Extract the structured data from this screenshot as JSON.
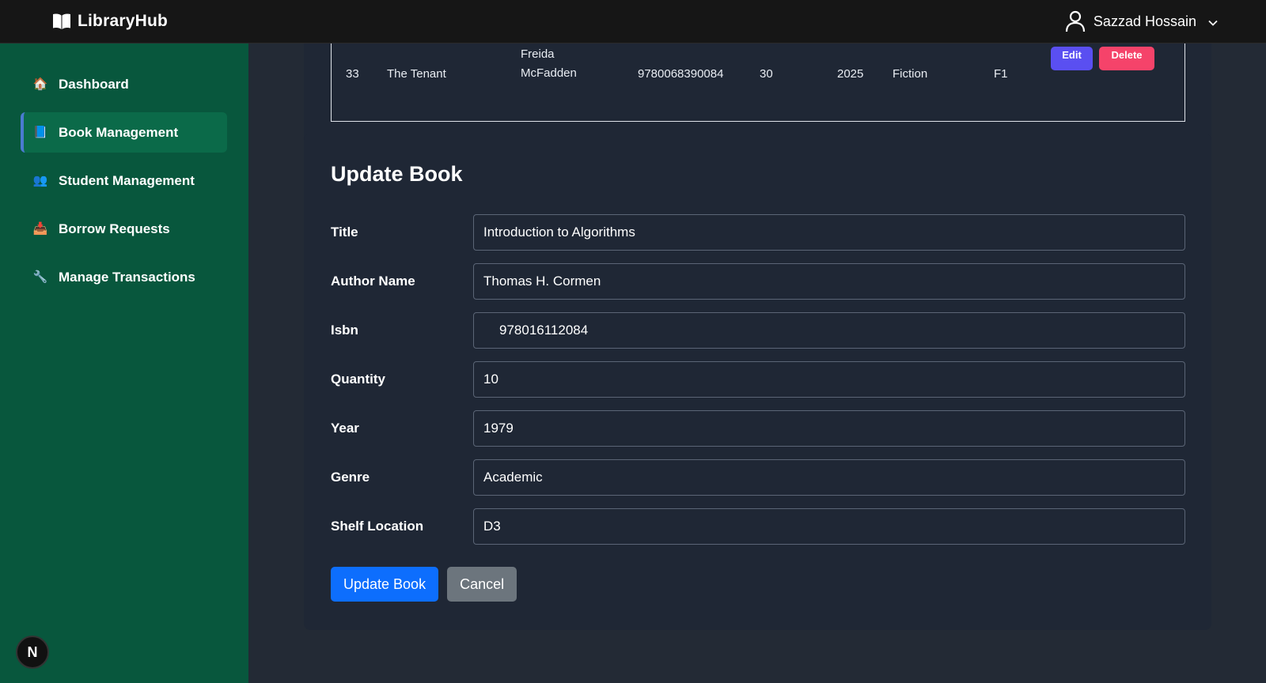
{
  "app": {
    "brand": "LibraryHub",
    "user_name": "Sazzad Hossain"
  },
  "sidebar": {
    "items": [
      {
        "label": "Dashboard",
        "icon": "🏠",
        "active": false
      },
      {
        "label": "Book Management",
        "icon": "📘",
        "active": true
      },
      {
        "label": "Student Management",
        "icon": "👥",
        "active": false
      },
      {
        "label": "Borrow Requests",
        "icon": "📥",
        "active": false
      },
      {
        "label": "Manage Transactions",
        "icon": "🔧",
        "active": false
      }
    ],
    "badge": "N"
  },
  "table": {
    "row": {
      "id": "33",
      "title": "The Tenant",
      "author_line1": "Freida",
      "author_line2": "McFadden",
      "isbn": "9780068390084",
      "quantity": "30",
      "year": "2025",
      "genre": "Fiction",
      "shelf": "F1",
      "edit_label": "Edit",
      "delete_label": "Delete"
    }
  },
  "form": {
    "title": "Update Book",
    "fields": [
      {
        "label": "Title",
        "value": "Introduction to Algorithms"
      },
      {
        "label": "Author Name",
        "value": "Thomas H. Cormen"
      },
      {
        "label": "Isbn",
        "value": "978016112084"
      },
      {
        "label": "Quantity",
        "value": "10"
      },
      {
        "label": "Year",
        "value": "1979"
      },
      {
        "label": "Genre",
        "value": "Academic"
      },
      {
        "label": "Shelf Location",
        "value": "D3"
      }
    ],
    "submit_label": "Update Book",
    "cancel_label": "Cancel"
  },
  "colors": {
    "sidebar": "#08573d",
    "topbar": "#161616",
    "card": "#1f2735",
    "primary": "#0d6efd",
    "edit": "#5a4ff1",
    "delete": "#f5436a"
  },
  "icons": {
    "brand": "book-open-icon",
    "user": "user-icon",
    "dropdown": "chevron-down-icon"
  }
}
